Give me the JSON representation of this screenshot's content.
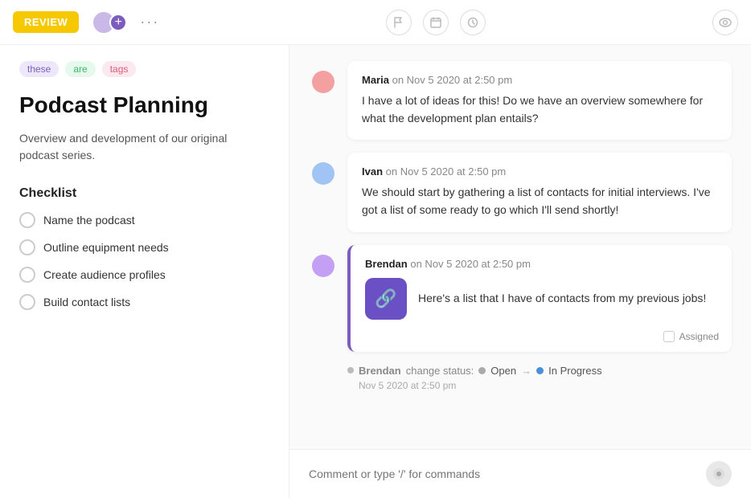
{
  "topbar": {
    "review_label": "REVIEW",
    "dots_label": "···",
    "icons": {
      "flag": "⚑",
      "calendar": "▭",
      "clock": "◷",
      "eye": "◎"
    }
  },
  "left_panel": {
    "tags": [
      {
        "id": "tag-these",
        "label": "these",
        "style": "tag-purple"
      },
      {
        "id": "tag-are",
        "label": "are",
        "style": "tag-green"
      },
      {
        "id": "tag-tags",
        "label": "tags",
        "style": "tag-pink"
      }
    ],
    "title": "Podcast Planning",
    "description": "Overview and development of our original podcast series.",
    "checklist_heading": "Checklist",
    "checklist_items": [
      {
        "id": "ci-1",
        "label": "Name the podcast"
      },
      {
        "id": "ci-2",
        "label": "Outline equipment needs"
      },
      {
        "id": "ci-3",
        "label": "Create audience profiles"
      },
      {
        "id": "ci-4",
        "label": "Build contact lists"
      }
    ]
  },
  "comments": [
    {
      "id": "comment-maria",
      "author": "Maria",
      "meta": "on Nov 5 2020 at 2:50 pm",
      "text": "I have a lot of ideas for this! Do we have an overview somewhere for what the development plan entails?",
      "avatar_color": "#f4a0a0",
      "highlighted": false,
      "has_attachment": false
    },
    {
      "id": "comment-ivan",
      "author": "Ivan",
      "meta": "on Nov 5 2020 at 2:50 pm",
      "text": "We should start by gathering a list of contacts for initial interviews. I've got a list of some ready to go which I'll send shortly!",
      "avatar_color": "#a0c4f4",
      "highlighted": false,
      "has_attachment": false
    },
    {
      "id": "comment-brendan",
      "author": "Brendan",
      "meta": "on Nov 5 2020 at 2:50 pm",
      "text": "Here's a list that I have of contacts from my previous jobs!",
      "avatar_color": "#c4a0f4",
      "highlighted": true,
      "has_attachment": true,
      "attachment_icon": "🔗",
      "assigned_label": "Assigned"
    }
  ],
  "status_change": {
    "author": "Brendan",
    "label_prefix": "change status:",
    "from_status": "Open",
    "to_status": "In Progress",
    "timestamp": "Nov 5 2020 at 2:50 pm"
  },
  "comment_input": {
    "placeholder": "Comment or type '/' for commands",
    "send_icon": "💬"
  }
}
